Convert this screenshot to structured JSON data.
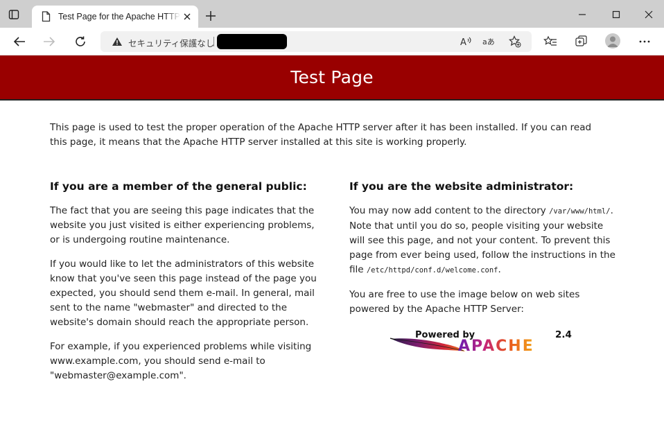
{
  "browser": {
    "tab_title": "Test Page for the Apache HTTP Server",
    "security_label": "セキュリティ保護なし",
    "read_aloud_label": "A",
    "translate_label": "aあ"
  },
  "page": {
    "banner_title": "Test Page",
    "intro": "This page is used to test the proper operation of the Apache HTTP server after it has been installed. If you can read this page, it means that the Apache HTTP server installed at this site is working properly.",
    "public": {
      "heading": "If you are a member of the general public:",
      "p1": "The fact that you are seeing this page indicates that the website you just visited is either experiencing problems, or is undergoing routine maintenance.",
      "p2": "If you would like to let the administrators of this website know that you've seen this page instead of the page you expected, you should send them e-mail. In general, mail sent to the name \"webmaster\" and directed to the website's domain should reach the appropriate person.",
      "p3": "For example, if you experienced problems while visiting www.example.com, you should send e-mail to \"webmaster@example.com\"."
    },
    "admin": {
      "heading": "If you are the website administrator:",
      "p1_a": "You may now add content to the directory ",
      "p1_dir": "/var/www/html/",
      "p1_b": ". Note that until you do so, people visiting your website will see this page, and not your content. To prevent this page from ever being used, follow the instructions in the file ",
      "p1_file": "/etc/httpd/conf.d/welcome.conf",
      "p1_c": ".",
      "p2": "You are free to use the image below on web sites powered by the Apache HTTP Server:"
    },
    "badge": {
      "powered_by": "Powered by",
      "apache": "APACHE",
      "version": "2.4"
    }
  }
}
